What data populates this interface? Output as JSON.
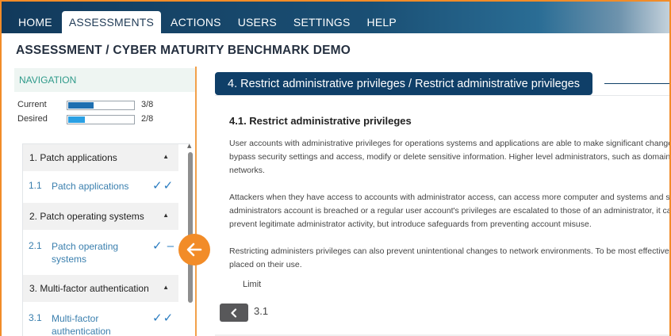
{
  "topnav": {
    "items": [
      {
        "label": "HOME",
        "active": false
      },
      {
        "label": "ASSESSMENTS",
        "active": true
      },
      {
        "label": "ACTIONS",
        "active": false
      },
      {
        "label": "USERS",
        "active": false
      },
      {
        "label": "SETTINGS",
        "active": false
      },
      {
        "label": "HELP",
        "active": false
      }
    ]
  },
  "page_title": "ASSESSMENT / CYBER MATURITY BENCHMARK DEMO",
  "navigation": {
    "header": "NAVIGATION",
    "progress": [
      {
        "label": "Current",
        "value": "3/8",
        "fraction": 0.375,
        "color": "#1f6fb0"
      },
      {
        "label": "Desired",
        "value": "2/8",
        "fraction": 0.25,
        "color": "#2aa0e4"
      }
    ],
    "sections": [
      {
        "title": "1. Patch applications",
        "items": [
          {
            "num": "1.1",
            "label": "Patch applications",
            "checks": "✓✓"
          }
        ]
      },
      {
        "title": "2. Patch operating systems",
        "items": [
          {
            "num": "2.1",
            "label": "Patch operating systems",
            "checks": "✓ –"
          }
        ]
      },
      {
        "title": "3. Multi-factor authentication",
        "items": [
          {
            "num": "3.1",
            "label": "Multi-factor authentication",
            "checks": "✓✓"
          }
        ]
      }
    ]
  },
  "main": {
    "section_title": "4. Restrict administrative privileges / Restrict administrative privileges",
    "sub_title": "4.1. Restrict administrative privileges",
    "paragraphs": [
      [
        "User accounts with administrative privileges for operations systems and applications are able to make significant changes to their configuration and operation,",
        "bypass security settings and access, modify or delete sensitive information. Higher level administrators, such as domain administrators have access to entire",
        "networks."
      ],
      [
        "Attackers when they have access to accounts with administrator access, can access more computer and systems and sensitive information. When an",
        "administrators account is breached or a regular user account's privileges are escalated to those of an administrator, it can be used to",
        "prevent legitimate administrator activity, but introduce safeguards from preventing account misuse."
      ],
      [
        "Restricting administers privileges can also prevent unintentional changes to network environments. To be most effective, restrictions should be",
        "placed on their use."
      ]
    ],
    "limit_label": "Limit",
    "back_label": "3.1"
  },
  "colors": {
    "accent": "#f28c28",
    "navy": "#0f3f68",
    "link": "#3a7fae"
  }
}
